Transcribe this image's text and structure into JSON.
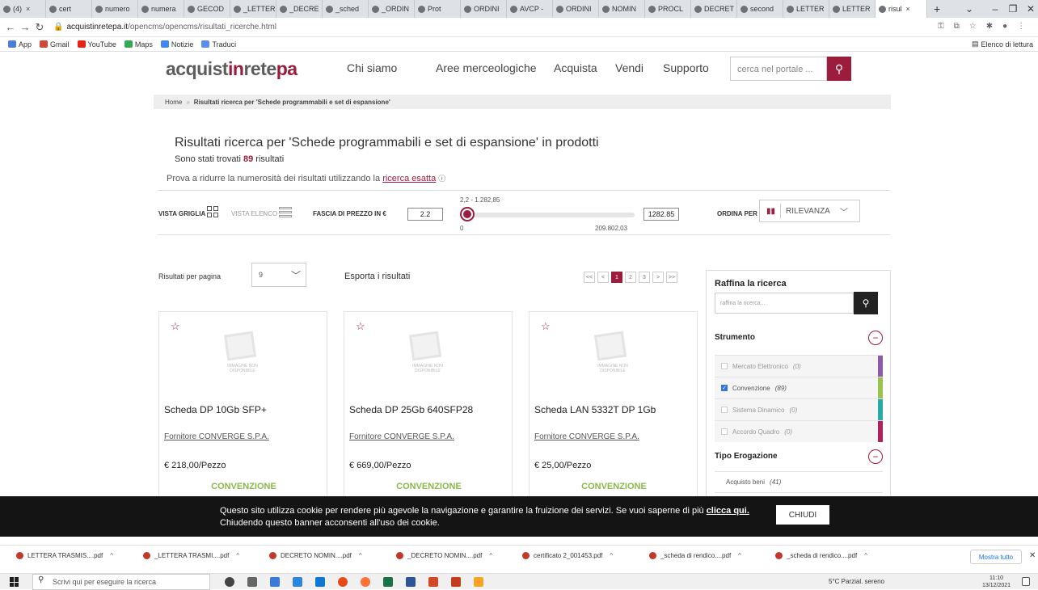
{
  "browser": {
    "tabs": [
      {
        "label": "(4)"
      },
      {
        "label": "cert"
      },
      {
        "label": "numero"
      },
      {
        "label": "numera"
      },
      {
        "label": "GECOD"
      },
      {
        "label": "_LETTER"
      },
      {
        "label": "_DECRE"
      },
      {
        "label": "_sched"
      },
      {
        "label": "_ORDIN"
      },
      {
        "label": "Prot"
      },
      {
        "label": "ORDINI"
      },
      {
        "label": "AVCP -"
      },
      {
        "label": "ORDINI"
      },
      {
        "label": "NOMIN"
      },
      {
        "label": "PROCL"
      },
      {
        "label": "DECRET"
      },
      {
        "label": "second"
      },
      {
        "label": "LETTER"
      },
      {
        "label": "LETTER"
      },
      {
        "label": "risul"
      }
    ],
    "new_tab": "+",
    "url_host": "acquistinretepa.it",
    "url_path": "/opencms/opencms/risultati_ricerche.html",
    "bookmarks": [
      "App",
      "Gmail",
      "YouTube",
      "Maps",
      "Notizie",
      "Traduci"
    ],
    "reading_list": "Elenco di lettura"
  },
  "site": {
    "logo_a": "acquist",
    "logo_b": "in",
    "logo_c": "rete",
    "logo_d": "pa",
    "nav": [
      "Chi siamo",
      "Aree merceologiche",
      "Acquista",
      "Vendi",
      "Supporto"
    ],
    "search_placeholder": "cerca nel portale ..."
  },
  "breadcrumb": {
    "home": "Home",
    "sep": "»",
    "current": "Risultati ricerca per 'Schede programmabili e set di espansione'"
  },
  "results": {
    "title": "Risultati ricerca per 'Schede programmabili e set di espansione' in prodotti",
    "count_prefix": "Sono stati trovati ",
    "count": "89",
    "count_suffix": " risultati",
    "hint": "Prova a ridurre la numerosità dei risultati utilizzando la ",
    "hint_link": "ricerca esatta"
  },
  "filters": {
    "grid_view": "VISTA GRIGLIA",
    "list_view": "VISTA ELENCO",
    "price_range": "FASCIA DI PREZZO IN €",
    "price_min": "2.2",
    "price_max": "1282.85",
    "range_label": "2,2 - 1.282,85",
    "scale_min": "0",
    "scale_max": "209.802,03",
    "sort_label": "ORDINA PER",
    "sort_value": "RILEVANZA"
  },
  "listing": {
    "per_page_label": "Risultati per pagina",
    "per_page_value": "9",
    "export": "Esporta i risultati",
    "pager": [
      "<<",
      "<",
      "1",
      "2",
      "3",
      ">",
      ">>"
    ]
  },
  "products": [
    {
      "name": "Scheda DP 10Gb SFP+",
      "supplier": "Fornitore CONVERGE S.P.A.",
      "price": "€ 218,00/Pezzo",
      "type": "CONVENZIONE"
    },
    {
      "name": "Scheda DP 25Gb 640SFP28",
      "supplier": "Fornitore CONVERGE S.P.A.",
      "price": "€ 669,00/Pezzo",
      "type": "CONVENZIONE"
    },
    {
      "name": "Scheda LAN 5332T DP 1Gb",
      "supplier": "Fornitore CONVERGE S.P.A.",
      "price": "€ 25,00/Pezzo",
      "type": "CONVENZIONE"
    }
  ],
  "placeholder_caption": "IMMAGINE NON DISPONIBILE",
  "sidebar": {
    "title": "Raffina la ricerca",
    "placeholder": "raffina la ricerca...",
    "strumento": "Strumento",
    "options": [
      {
        "label": "Mercato Elettronico",
        "count": "(0)",
        "color": "#8e5aa8"
      },
      {
        "label": "Convenzione",
        "count": "(89)",
        "color": "#9bc250"
      },
      {
        "label": "Sistema Dinamico",
        "count": "(0)",
        "color": "#2aa9a9"
      },
      {
        "label": "Accordo Quadro",
        "count": "(0)",
        "color": "#b0235a"
      }
    ],
    "tipo": "Tipo Erogazione",
    "tipo_options": [
      {
        "label": "Acquisto beni",
        "count": "(41)"
      }
    ]
  },
  "cookie": {
    "text": "Questo sito utilizza cookie per rendere più agevole la navigazione e garantire la fruizione dei servizi. Se vuoi saperne di più ",
    "link": "clicca qui.",
    "text2": "Chiudendo questo banner acconsenti all'uso dei cookie.",
    "close": "CHIUDI"
  },
  "downloads": {
    "items": [
      "LETTERA TRASMIS....pdf",
      "_LETTERA TRASMI....pdf",
      "DECRETO NOMIN....pdf",
      "_DECRETO NOMIN....pdf",
      "certificato 2_001453.pdf",
      "_scheda di rendico....pdf",
      "_scheda di rendico....pdf"
    ],
    "show_all": "Mostra tutto"
  },
  "taskbar": {
    "search": "Scrivi qui per eseguire la ricerca",
    "weather": "5°C Parzial. sereno",
    "time": "11:10",
    "date": "13/12/2021"
  },
  "colors": {
    "brand": "#9c1c3d",
    "convenzione": "#8ab84a"
  }
}
